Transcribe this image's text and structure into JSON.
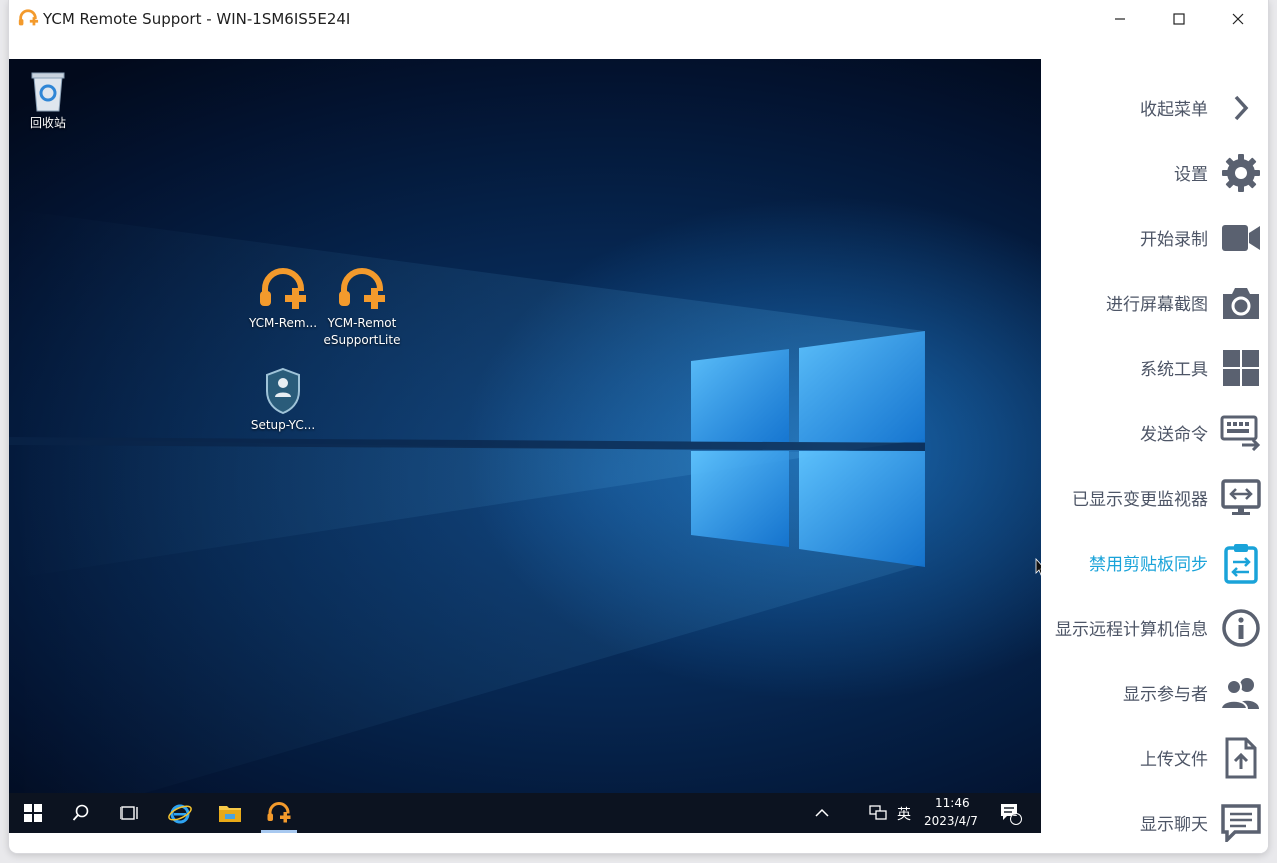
{
  "window": {
    "title": "YCM Remote Support - WIN-1SM6IS5E24I",
    "controls": [
      "minimize-icon",
      "maximize-icon",
      "close-icon"
    ]
  },
  "desktop": {
    "icons": [
      {
        "label": "回收站",
        "icon": "recycle-bin-icon"
      },
      {
        "label": "YCM-Rem...",
        "icon": "headset-plus-icon"
      },
      {
        "label": "YCM-Remot\neSupportLite",
        "icon": "headset-plus-icon"
      },
      {
        "label": "Setup-YC...",
        "icon": "setup-shield-icon"
      }
    ]
  },
  "taskbar": {
    "apps": [
      "windows-start-icon",
      "search-icon",
      "task-view-icon",
      "ie-icon",
      "file-explorer-icon",
      "ycm-icon"
    ],
    "tray": {
      "ime": "英",
      "time": "11:46",
      "date": "2023/4/7",
      "notification_count": "1"
    }
  },
  "menu": {
    "items": [
      {
        "label": "收起菜单",
        "icon": "chevron-right-icon",
        "active": false
      },
      {
        "label": "设置",
        "icon": "gear-icon",
        "active": false
      },
      {
        "label": "开始录制",
        "icon": "video-camera-icon",
        "active": false
      },
      {
        "label": "进行屏幕截图",
        "icon": "camera-icon",
        "active": false
      },
      {
        "label": "系统工具",
        "icon": "grid-icon",
        "active": false
      },
      {
        "label": "发送命令",
        "icon": "keyboard-send-icon",
        "active": false
      },
      {
        "label": "已显示变更监视器",
        "icon": "monitor-switch-icon",
        "active": false
      },
      {
        "label": "禁用剪贴板同步",
        "icon": "clipboard-sync-icon",
        "active": true
      },
      {
        "label": "显示远程计算机信息",
        "icon": "info-icon",
        "active": false
      },
      {
        "label": "显示参与者",
        "icon": "participants-icon",
        "active": false
      },
      {
        "label": "上传文件",
        "icon": "upload-file-icon",
        "active": false
      },
      {
        "label": "显示聊天",
        "icon": "chat-icon",
        "active": false
      }
    ],
    "colors": {
      "default": "#4d5566",
      "active": "#1aa3d9"
    }
  }
}
